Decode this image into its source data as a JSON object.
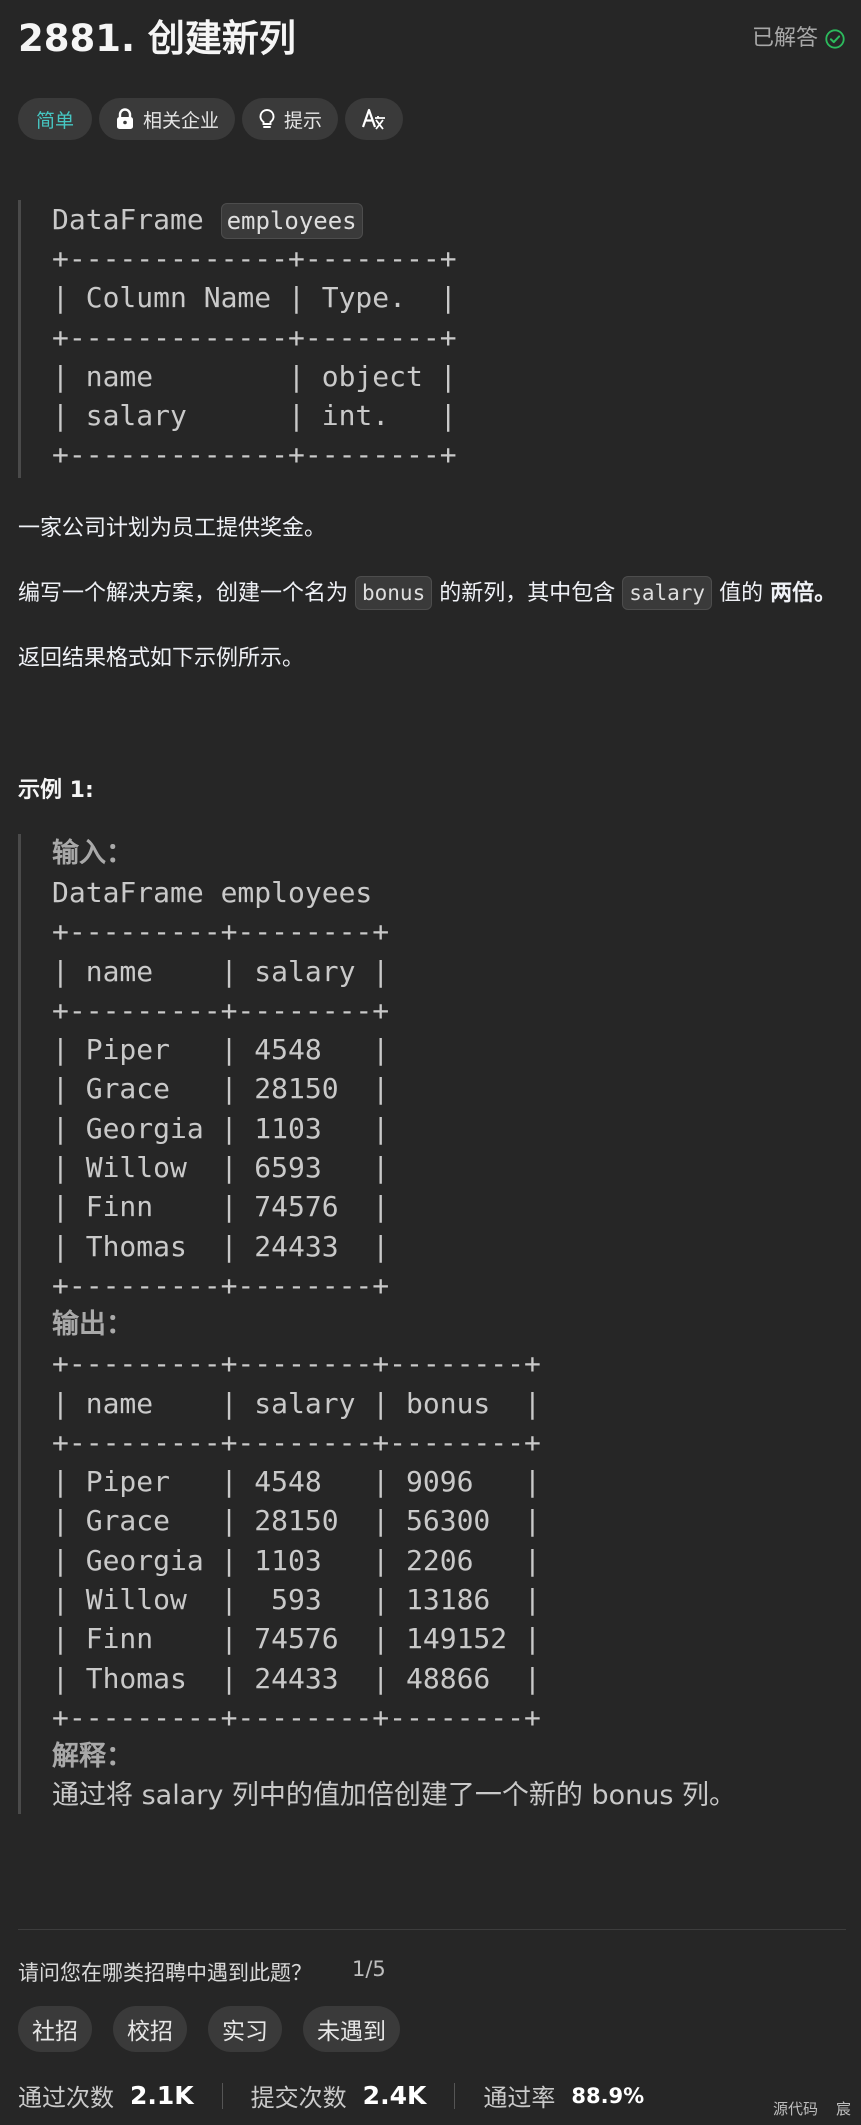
{
  "header": {
    "title": "2881. 创建新列",
    "solved_label": "已解答"
  },
  "tags": {
    "difficulty": "简单",
    "companies": "相关企业",
    "hint": "提示"
  },
  "schema": {
    "df_label": "DataFrame",
    "df_name": "employees",
    "table": "+-------------+--------+\n| Column Name | Type.  |\n+-------------+--------+\n| name        | object |\n| salary      | int.   |\n+-------------+--------+"
  },
  "description": {
    "p1": "一家公司计划为员工提供奖金。",
    "p2_a": "编写一个解决方案，创建一个名为 ",
    "p2_code1": "bonus",
    "p2_b": " 的新列，其中包含 ",
    "p2_code2": "salary",
    "p2_c": " 值的 ",
    "p2_bold": "两倍。",
    "p3": "返回结果格式如下示例所示。"
  },
  "example": {
    "heading": "示例 1:",
    "input_label": "输入：",
    "input_table": "DataFrame employees\n+---------+--------+\n| name    | salary |\n+---------+--------+\n| Piper   | 4548   |\n| Grace   | 28150  |\n| Georgia | 1103   |\n| Willow  | 6593   |\n| Finn    | 74576  |\n| Thomas  | 24433  |\n+---------+--------+",
    "output_label": "输出：",
    "output_table": "+---------+--------+--------+\n| name    | salary | bonus  |\n+---------+--------+--------+\n| Piper   | 4548   | 9096   |\n| Grace   | 28150  | 56300  |\n| Georgia | 1103   | 2206   |\n| Willow  |  593   | 13186  |\n| Finn    | 74576  | 149152 |\n| Thomas  | 24433  | 48866  |\n+---------+--------+--------+",
    "explanation_label": "解释：",
    "explanation_text": "通过将 salary 列中的值加倍创建了一个新的 bonus 列。"
  },
  "survey": {
    "question": "请问您在哪类招聘中遇到此题？",
    "count": "1/5",
    "options": [
      "社招",
      "校招",
      "实习",
      "未遇到"
    ]
  },
  "stats": {
    "accepted_label": "通过次数",
    "accepted_value": "2.1K",
    "submissions_label": "提交次数",
    "submissions_value": "2.4K",
    "rate_label": "通过率",
    "rate_value": "88.9%"
  },
  "footer": {
    "source_code": "源代码",
    "extra": "宸"
  },
  "colors": {
    "background": "#262626",
    "easy": "#46c6c2",
    "solved_check": "#2cbb5d"
  }
}
